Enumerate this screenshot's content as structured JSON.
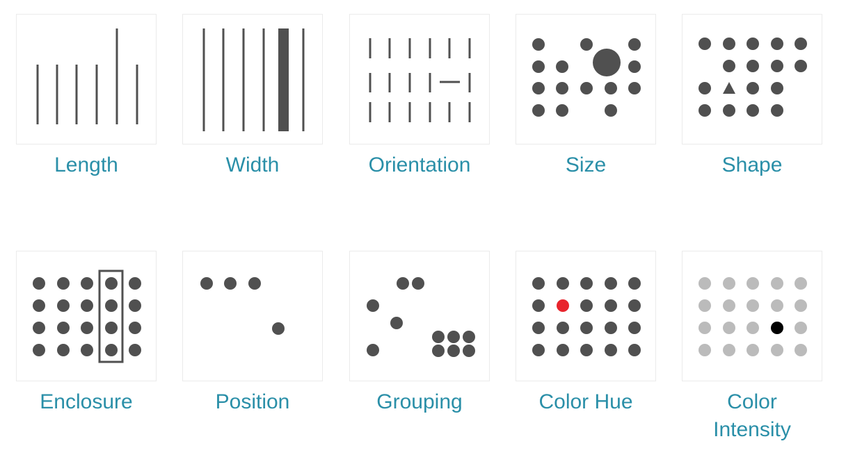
{
  "colors": {
    "mark": "#505050",
    "accent_red": "#e8242c",
    "light_gray": "#bbbbbb",
    "black": "#000000",
    "label": "#2a8fa8",
    "border": "#ebebeb"
  },
  "tiles": [
    {
      "id": "length",
      "label": "Length",
      "icon": "length-icon"
    },
    {
      "id": "width",
      "label": "Width",
      "icon": "width-icon"
    },
    {
      "id": "orientation",
      "label": "Orientation",
      "icon": "orientation-icon"
    },
    {
      "id": "size",
      "label": "Size",
      "icon": "size-icon"
    },
    {
      "id": "shape",
      "label": "Shape",
      "icon": "shape-icon"
    },
    {
      "id": "enclosure",
      "label": "Enclosure",
      "icon": "enclosure-icon"
    },
    {
      "id": "position",
      "label": "Position",
      "icon": "position-icon"
    },
    {
      "id": "grouping",
      "label": "Grouping",
      "icon": "grouping-icon"
    },
    {
      "id": "color-hue",
      "label": "Color Hue",
      "icon": "color-hue-icon"
    },
    {
      "id": "color-intensity",
      "label": "Color\nIntensity",
      "icon": "color-intensity-icon"
    }
  ]
}
